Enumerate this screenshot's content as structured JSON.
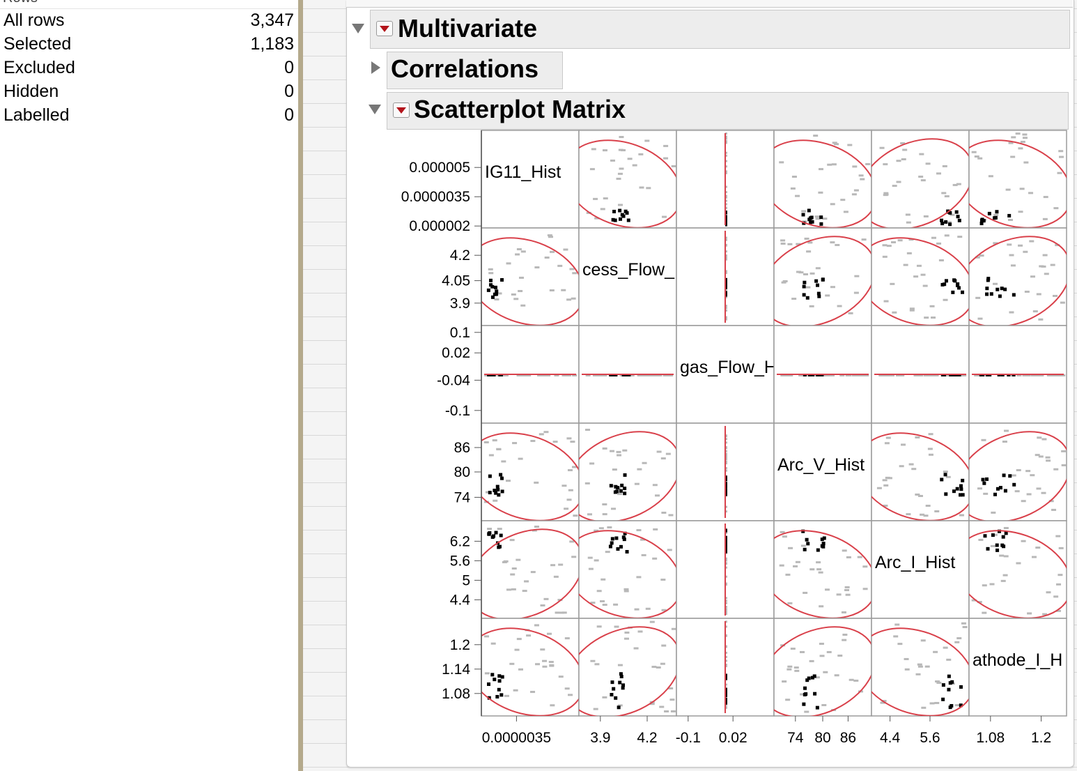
{
  "rows_panel": {
    "header_label": "Rows",
    "items": [
      {
        "label": "All rows",
        "value": "3,347"
      },
      {
        "label": "Selected",
        "value": "1,183"
      },
      {
        "label": "Excluded",
        "value": "0"
      },
      {
        "label": "Hidden",
        "value": "0"
      },
      {
        "label": "Labelled",
        "value": "0"
      }
    ]
  },
  "report": {
    "multivariate_title": "Multivariate",
    "correlations_title": "Correlations",
    "scatterplot_title": "Scatterplot Matrix"
  },
  "colors": {
    "ellipse": "#d9404a",
    "selected_points": "#000000",
    "unselected_points": "#b8b8b8",
    "menu_triangle": "#b3141b"
  },
  "chart_data": {
    "type": "scatter",
    "variables": [
      "IG11_Hist",
      "cess_Flow_",
      "gas_Flow_H",
      "Arc_V_Hist",
      "Arc_I_Hist",
      "athode_I_H"
    ],
    "y_axes": [
      {
        "ticks": [
          "0.000005",
          "0.0000035",
          "0.000002"
        ]
      },
      {
        "ticks": [
          "4.2",
          "4.05",
          "3.9"
        ]
      },
      {
        "ticks": [
          "0.1",
          "0.02",
          "-0.04",
          "-0.1"
        ]
      },
      {
        "ticks": [
          "86",
          "80",
          "74"
        ]
      },
      {
        "ticks": [
          "6.2",
          "5.6",
          "5",
          "4.4"
        ]
      },
      {
        "ticks": [
          "1.2",
          "1.14",
          "1.08"
        ]
      }
    ],
    "x_axes": [
      {
        "ticks": [
          "0.0000035"
        ]
      },
      {
        "ticks": [
          "3.9",
          "4.2"
        ]
      },
      {
        "ticks": [
          "-0.1",
          "0.02"
        ]
      },
      {
        "ticks": [
          "74",
          "80",
          "86"
        ]
      },
      {
        "ticks": [
          "4.4",
          "5.6"
        ]
      },
      {
        "ticks": [
          "1.08",
          "1.2"
        ]
      }
    ],
    "density_ellipses": true,
    "grid": false
  }
}
